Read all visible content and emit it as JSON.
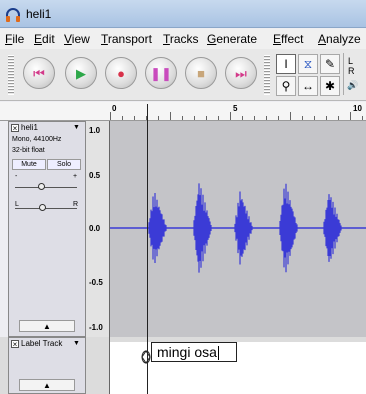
{
  "window": {
    "title": "heli1"
  },
  "menu": [
    "File",
    "Edit",
    "View",
    "Transport",
    "Tracks",
    "Generate",
    "Effect",
    "Analyze"
  ],
  "transport": {
    "buttons": [
      {
        "name": "skip-start",
        "glyph": "⏮",
        "color": "#d33a8a"
      },
      {
        "name": "play",
        "glyph": "▶",
        "color": "#2ea84a"
      },
      {
        "name": "record",
        "glyph": "●",
        "color": "#d8324a"
      },
      {
        "name": "pause",
        "glyph": "❚❚",
        "color": "#c94bbd"
      },
      {
        "name": "stop",
        "glyph": "■",
        "color": "#c8a67a"
      },
      {
        "name": "skip-end",
        "glyph": "⏭",
        "color": "#d33a8a"
      }
    ]
  },
  "tools": [
    {
      "name": "selection-tool",
      "glyph": "I"
    },
    {
      "name": "envelope-tool",
      "glyph": "⧖"
    },
    {
      "name": "draw-tool",
      "glyph": "✎"
    },
    {
      "name": "zoom-tool",
      "glyph": "⚲"
    },
    {
      "name": "timeshift-tool",
      "glyph": "↔"
    },
    {
      "name": "multi-tool",
      "glyph": "✱"
    }
  ],
  "meter": {
    "l": "L",
    "r": "R"
  },
  "ruler": {
    "labels": [
      "0",
      "5",
      "10"
    ]
  },
  "audio_track": {
    "name": "heli1",
    "rate": "Mono, 44100Hz",
    "format": "32-bit float",
    "mute": "Mute",
    "solo": "Solo",
    "gain_minus": "-",
    "gain_plus": "+",
    "pan_left": "L",
    "pan_right": "R",
    "scale": [
      "1.0",
      "0.5",
      "0.0",
      "-0.5",
      "-1.0"
    ],
    "wave_color": "#3b3bd6"
  },
  "label_track": {
    "name": "Label Track",
    "label_text": "mingi osa"
  }
}
